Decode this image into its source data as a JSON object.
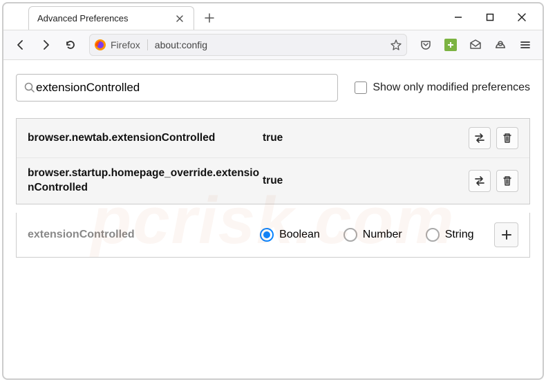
{
  "window": {
    "tab_title": "Advanced Preferences",
    "identity_label": "Firefox",
    "url": "about:config"
  },
  "search": {
    "placeholder": "",
    "value": "extensionControlled"
  },
  "filter": {
    "checkbox_label": "Show only modified preferences",
    "checked": false
  },
  "prefs": {
    "rows": [
      {
        "name": "browser.newtab.extensionControlled",
        "value": "true",
        "bold": true
      },
      {
        "name": "browser.startup.homepage_override.extensionControlled",
        "value": "true",
        "bold": true
      }
    ]
  },
  "new_pref": {
    "name": "extensionControlled",
    "types": {
      "boolean": "Boolean",
      "number": "Number",
      "string": "String"
    },
    "selected": "boolean"
  },
  "watermark": "pcrisk.com"
}
